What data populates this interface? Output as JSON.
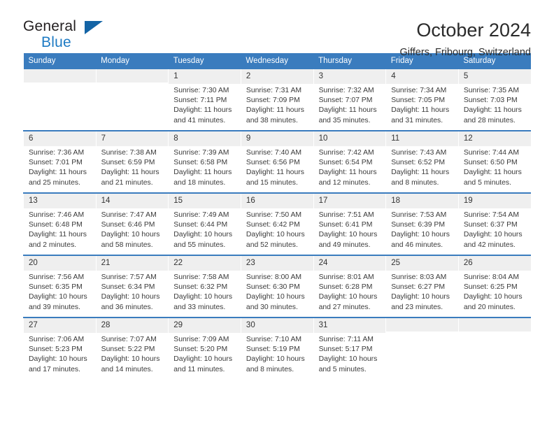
{
  "brand": {
    "name_part1": "General",
    "name_part2": "Blue",
    "triangle_color": "#1464a5",
    "blue_color": "#1e7bc4"
  },
  "header": {
    "title": "October 2024",
    "location": "Giffers, Fribourg, Switzerland"
  },
  "theme": {
    "header_bg": "#3a7cbe",
    "daynum_bg": "#efefef",
    "rule_color": "#3a7cbe"
  },
  "calendar": {
    "weekday_headers": [
      "Sunday",
      "Monday",
      "Tuesday",
      "Wednesday",
      "Thursday",
      "Friday",
      "Saturday"
    ],
    "weeks": [
      [
        {
          "day": "",
          "blank": true,
          "sunrise": "",
          "sunset": "",
          "daylight_line1": "",
          "daylight_line2": ""
        },
        {
          "day": "",
          "blank": true,
          "sunrise": "",
          "sunset": "",
          "daylight_line1": "",
          "daylight_line2": ""
        },
        {
          "day": "1",
          "blank": false,
          "sunrise": "Sunrise: 7:30 AM",
          "sunset": "Sunset: 7:11 PM",
          "daylight_line1": "Daylight: 11 hours",
          "daylight_line2": "and 41 minutes."
        },
        {
          "day": "2",
          "blank": false,
          "sunrise": "Sunrise: 7:31 AM",
          "sunset": "Sunset: 7:09 PM",
          "daylight_line1": "Daylight: 11 hours",
          "daylight_line2": "and 38 minutes."
        },
        {
          "day": "3",
          "blank": false,
          "sunrise": "Sunrise: 7:32 AM",
          "sunset": "Sunset: 7:07 PM",
          "daylight_line1": "Daylight: 11 hours",
          "daylight_line2": "and 35 minutes."
        },
        {
          "day": "4",
          "blank": false,
          "sunrise": "Sunrise: 7:34 AM",
          "sunset": "Sunset: 7:05 PM",
          "daylight_line1": "Daylight: 11 hours",
          "daylight_line2": "and 31 minutes."
        },
        {
          "day": "5",
          "blank": false,
          "sunrise": "Sunrise: 7:35 AM",
          "sunset": "Sunset: 7:03 PM",
          "daylight_line1": "Daylight: 11 hours",
          "daylight_line2": "and 28 minutes."
        }
      ],
      [
        {
          "day": "6",
          "blank": false,
          "sunrise": "Sunrise: 7:36 AM",
          "sunset": "Sunset: 7:01 PM",
          "daylight_line1": "Daylight: 11 hours",
          "daylight_line2": "and 25 minutes."
        },
        {
          "day": "7",
          "blank": false,
          "sunrise": "Sunrise: 7:38 AM",
          "sunset": "Sunset: 6:59 PM",
          "daylight_line1": "Daylight: 11 hours",
          "daylight_line2": "and 21 minutes."
        },
        {
          "day": "8",
          "blank": false,
          "sunrise": "Sunrise: 7:39 AM",
          "sunset": "Sunset: 6:58 PM",
          "daylight_line1": "Daylight: 11 hours",
          "daylight_line2": "and 18 minutes."
        },
        {
          "day": "9",
          "blank": false,
          "sunrise": "Sunrise: 7:40 AM",
          "sunset": "Sunset: 6:56 PM",
          "daylight_line1": "Daylight: 11 hours",
          "daylight_line2": "and 15 minutes."
        },
        {
          "day": "10",
          "blank": false,
          "sunrise": "Sunrise: 7:42 AM",
          "sunset": "Sunset: 6:54 PM",
          "daylight_line1": "Daylight: 11 hours",
          "daylight_line2": "and 12 minutes."
        },
        {
          "day": "11",
          "blank": false,
          "sunrise": "Sunrise: 7:43 AM",
          "sunset": "Sunset: 6:52 PM",
          "daylight_line1": "Daylight: 11 hours",
          "daylight_line2": "and 8 minutes."
        },
        {
          "day": "12",
          "blank": false,
          "sunrise": "Sunrise: 7:44 AM",
          "sunset": "Sunset: 6:50 PM",
          "daylight_line1": "Daylight: 11 hours",
          "daylight_line2": "and 5 minutes."
        }
      ],
      [
        {
          "day": "13",
          "blank": false,
          "sunrise": "Sunrise: 7:46 AM",
          "sunset": "Sunset: 6:48 PM",
          "daylight_line1": "Daylight: 11 hours",
          "daylight_line2": "and 2 minutes."
        },
        {
          "day": "14",
          "blank": false,
          "sunrise": "Sunrise: 7:47 AM",
          "sunset": "Sunset: 6:46 PM",
          "daylight_line1": "Daylight: 10 hours",
          "daylight_line2": "and 58 minutes."
        },
        {
          "day": "15",
          "blank": false,
          "sunrise": "Sunrise: 7:49 AM",
          "sunset": "Sunset: 6:44 PM",
          "daylight_line1": "Daylight: 10 hours",
          "daylight_line2": "and 55 minutes."
        },
        {
          "day": "16",
          "blank": false,
          "sunrise": "Sunrise: 7:50 AM",
          "sunset": "Sunset: 6:42 PM",
          "daylight_line1": "Daylight: 10 hours",
          "daylight_line2": "and 52 minutes."
        },
        {
          "day": "17",
          "blank": false,
          "sunrise": "Sunrise: 7:51 AM",
          "sunset": "Sunset: 6:41 PM",
          "daylight_line1": "Daylight: 10 hours",
          "daylight_line2": "and 49 minutes."
        },
        {
          "day": "18",
          "blank": false,
          "sunrise": "Sunrise: 7:53 AM",
          "sunset": "Sunset: 6:39 PM",
          "daylight_line1": "Daylight: 10 hours",
          "daylight_line2": "and 46 minutes."
        },
        {
          "day": "19",
          "blank": false,
          "sunrise": "Sunrise: 7:54 AM",
          "sunset": "Sunset: 6:37 PM",
          "daylight_line1": "Daylight: 10 hours",
          "daylight_line2": "and 42 minutes."
        }
      ],
      [
        {
          "day": "20",
          "blank": false,
          "sunrise": "Sunrise: 7:56 AM",
          "sunset": "Sunset: 6:35 PM",
          "daylight_line1": "Daylight: 10 hours",
          "daylight_line2": "and 39 minutes."
        },
        {
          "day": "21",
          "blank": false,
          "sunrise": "Sunrise: 7:57 AM",
          "sunset": "Sunset: 6:34 PM",
          "daylight_line1": "Daylight: 10 hours",
          "daylight_line2": "and 36 minutes."
        },
        {
          "day": "22",
          "blank": false,
          "sunrise": "Sunrise: 7:58 AM",
          "sunset": "Sunset: 6:32 PM",
          "daylight_line1": "Daylight: 10 hours",
          "daylight_line2": "and 33 minutes."
        },
        {
          "day": "23",
          "blank": false,
          "sunrise": "Sunrise: 8:00 AM",
          "sunset": "Sunset: 6:30 PM",
          "daylight_line1": "Daylight: 10 hours",
          "daylight_line2": "and 30 minutes."
        },
        {
          "day": "24",
          "blank": false,
          "sunrise": "Sunrise: 8:01 AM",
          "sunset": "Sunset: 6:28 PM",
          "daylight_line1": "Daylight: 10 hours",
          "daylight_line2": "and 27 minutes."
        },
        {
          "day": "25",
          "blank": false,
          "sunrise": "Sunrise: 8:03 AM",
          "sunset": "Sunset: 6:27 PM",
          "daylight_line1": "Daylight: 10 hours",
          "daylight_line2": "and 23 minutes."
        },
        {
          "day": "26",
          "blank": false,
          "sunrise": "Sunrise: 8:04 AM",
          "sunset": "Sunset: 6:25 PM",
          "daylight_line1": "Daylight: 10 hours",
          "daylight_line2": "and 20 minutes."
        }
      ],
      [
        {
          "day": "27",
          "blank": false,
          "sunrise": "Sunrise: 7:06 AM",
          "sunset": "Sunset: 5:23 PM",
          "daylight_line1": "Daylight: 10 hours",
          "daylight_line2": "and 17 minutes."
        },
        {
          "day": "28",
          "blank": false,
          "sunrise": "Sunrise: 7:07 AM",
          "sunset": "Sunset: 5:22 PM",
          "daylight_line1": "Daylight: 10 hours",
          "daylight_line2": "and 14 minutes."
        },
        {
          "day": "29",
          "blank": false,
          "sunrise": "Sunrise: 7:09 AM",
          "sunset": "Sunset: 5:20 PM",
          "daylight_line1": "Daylight: 10 hours",
          "daylight_line2": "and 11 minutes."
        },
        {
          "day": "30",
          "blank": false,
          "sunrise": "Sunrise: 7:10 AM",
          "sunset": "Sunset: 5:19 PM",
          "daylight_line1": "Daylight: 10 hours",
          "daylight_line2": "and 8 minutes."
        },
        {
          "day": "31",
          "blank": false,
          "sunrise": "Sunrise: 7:11 AM",
          "sunset": "Sunset: 5:17 PM",
          "daylight_line1": "Daylight: 10 hours",
          "daylight_line2": "and 5 minutes."
        },
        {
          "day": "",
          "blank": true,
          "sunrise": "",
          "sunset": "",
          "daylight_line1": "",
          "daylight_line2": ""
        },
        {
          "day": "",
          "blank": true,
          "sunrise": "",
          "sunset": "",
          "daylight_line1": "",
          "daylight_line2": ""
        }
      ]
    ]
  }
}
